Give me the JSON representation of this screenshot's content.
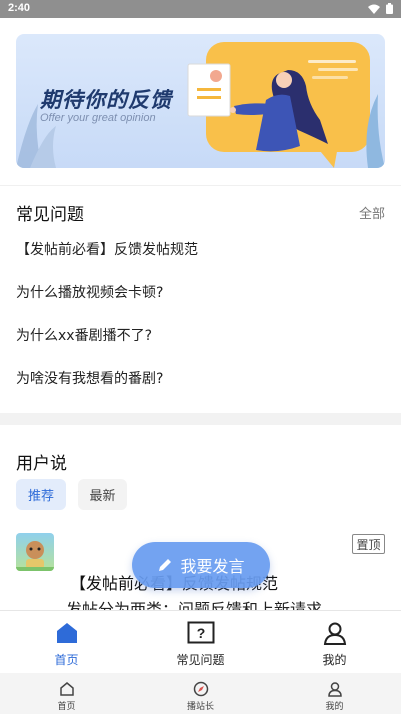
{
  "status_bar": {
    "time": "2:40",
    "icons": [
      "wifi-icon",
      "battery-icon"
    ]
  },
  "banner": {
    "title": "期待你的反馈",
    "subtitle": "Offer your great opinion"
  },
  "faq": {
    "title": "常见问题",
    "all_label": "全部",
    "items": [
      "【发帖前必看】反馈发帖规范",
      "为什么播放视频会卡顿?",
      "为什么xx番剧播不了?",
      "为啥没有我想看的番剧?"
    ]
  },
  "user_says": {
    "title": "用户说",
    "tabs": [
      {
        "label": "推荐",
        "active": true
      },
      {
        "label": "最新",
        "active": false
      }
    ]
  },
  "post": {
    "pinned_label": "置顶",
    "title": "【发帖前必看】反馈发帖规范",
    "snippet": "发帖分为两类：问题反馈和上新请求"
  },
  "fab": {
    "label": "我要发言",
    "icon": "pencil-icon"
  },
  "tab_bar": [
    {
      "label": "首页",
      "icon": "home-icon",
      "active": true
    },
    {
      "label": "常见问题",
      "icon": "question-icon",
      "active": false
    },
    {
      "label": "我的",
      "icon": "user-icon",
      "active": false
    }
  ],
  "bottom_nav": [
    {
      "label": "首页",
      "icon": "home-icon"
    },
    {
      "label": "播站长",
      "icon": "compass-icon"
    },
    {
      "label": "我的",
      "icon": "user-icon"
    }
  ],
  "colors": {
    "accent": "#2e6bd8",
    "fab": "#689cf0",
    "banner_bg": "#cfe0f8",
    "banner_card": "#f9c04a"
  }
}
